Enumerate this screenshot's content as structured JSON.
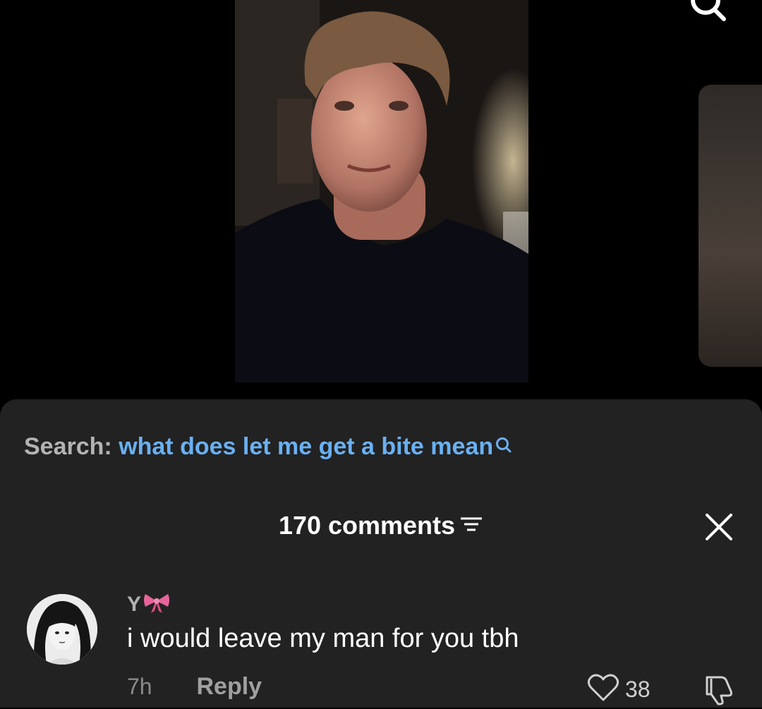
{
  "search": {
    "prefix": "Search:",
    "query": "what does let me get a bite mean"
  },
  "comments": {
    "header": "170 comments"
  },
  "comment": {
    "username": "Y",
    "text": "i would leave my man for you tbh",
    "time": "7h",
    "reply_label": "Reply",
    "likes": "38"
  },
  "icons": {
    "top_search": "search-icon",
    "inline_search": "search-icon",
    "filter": "filter-icon",
    "close": "close-icon",
    "bow": "bow-emoji",
    "like": "heart-icon",
    "dislike": "thumbs-down-icon"
  },
  "colors": {
    "sheet_background": "#222222",
    "search_query": "#6ab0f3",
    "bow": "#e7649a"
  }
}
